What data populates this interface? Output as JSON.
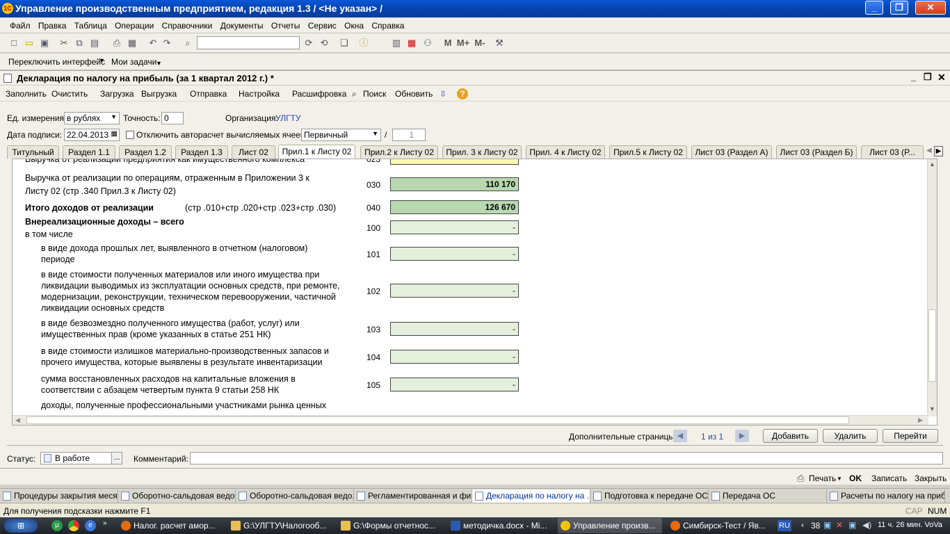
{
  "app": {
    "title": "Управление производственным предприятием, редакция 1.3 / <Не указан> /",
    "logo": "1С"
  },
  "menu": [
    "Файл",
    "Правка",
    "Таблица",
    "Операции",
    "Справочники",
    "Документы",
    "Отчеты",
    "Сервис",
    "Окна",
    "Справка"
  ],
  "toolbar": {
    "search_value": "",
    "m": "M",
    "m_plus": "M+",
    "m_minus": "M-"
  },
  "toolbar2": {
    "switch_interface": "Переключить интерфейс",
    "my_tasks": "Мои задачи"
  },
  "document": {
    "title": "Декларация по налогу на прибыль (за 1 квартал 2012 г.) *",
    "menu": [
      "Заполнить",
      "Очистить",
      "Загрузка",
      "Выгрузка",
      "Отправка",
      "Настройка",
      "Расшифровка",
      "Поиск",
      "Обновить"
    ],
    "units_label": "Ед. измерения:",
    "units_value": "в рублях",
    "precision_label": "Точность:",
    "precision_value": "0",
    "org_label": "Организация:",
    "org_value": "УЛГТУ",
    "sign_date_label": "Дата подписи:",
    "sign_date_value": "22.04.2013",
    "autocalc_label": "Отключить авторасчет вычисляемых ячеек",
    "doc_type_value": "Первичный",
    "slash": "/",
    "correction_value": "1"
  },
  "tabs": [
    "Титульный",
    "Раздел 1.1",
    "Раздел 1.2",
    "Раздел 1.3",
    "Лист 02",
    "Прил.1 к Листу 02",
    "Прил.2 к Листу 02",
    "Прил. 3 к Листу 02",
    "Прил. 4 к Листу 02",
    "Прил.5 к Листу 02",
    "Лист 03 (Раздел А)",
    "Лист 03 (Раздел Б)",
    "Лист 03 (Р..."
  ],
  "active_tab_index": 5,
  "sheet": {
    "top_partial": {
      "text": "Выручка от реализации предприятия как имущественного комплекса",
      "code": "023",
      "value": "-"
    },
    "rows": [
      {
        "l1": "Выручка от реализации по операциям, отраженным в Приложении 3 к",
        "l2": "Листу 02 (стр .340 Прил.3 к Листу 02)",
        "code": "030",
        "value": "110 170"
      },
      {
        "l1": "Итого доходов от реализации",
        "extra": "(стр .010+стр .020+стр .023+стр .030)",
        "code": "040",
        "value": "126 670"
      },
      {
        "l1": "Внереализационные доходы – всего",
        "l2": "в том числе",
        "code": "100",
        "value": "-"
      },
      {
        "l1": "в виде дохода прошлых лет, выявленного в отчетном (налоговом)",
        "l2": "периоде",
        "code": "101",
        "value": "-"
      },
      {
        "l1": "в виде стоимости полученных материалов или иного имущества при",
        "l2": "ликвидации выводимых из эксплуатации основных средств, при ремонте,",
        "l3": "модернизации, реконструкции, техническом перевооружении, частичной",
        "l4": "ликвидации основных средств",
        "code": "102",
        "value": "-"
      },
      {
        "l1": "в виде безвозмездно полученного имущества (работ, услуг) или",
        "l2": "имущественных прав (кроме указанных в статье 251 НК)",
        "code": "103",
        "value": "-"
      },
      {
        "l1": "в виде стоимости излишков материально-производственных запасов и",
        "l2": "прочего имущества, которые выявлены в результате инвентаризации",
        "code": "104",
        "value": "-"
      },
      {
        "l1": "сумма восстановленных расходов на капитальные вложения в",
        "l2": "соответствии с абзацем четвертым пункта 9 статьи 258 НК",
        "code": "105",
        "value": "-"
      },
      {
        "l1": "доходы, полученные профессиональными участниками рынка ценных"
      }
    ]
  },
  "pages": {
    "label": "Дополнительные страницы:",
    "counter": "1 из 1",
    "add": "Добавить",
    "delete": "Удалить",
    "go": "Перейти"
  },
  "footer": {
    "status_label": "Статус:",
    "status_value": "В работе",
    "comment_label": "Комментарий:",
    "comment_value": "",
    "print": "Печать",
    "ok": "OK",
    "save": "Записать",
    "close": "Закрыть"
  },
  "window_tasks": [
    "Процедуры закрытия меся...",
    "Оборотно-сальдовая ведо...",
    "Оборотно-сальдовая ведо...",
    "Регламентированная и фи...",
    "Декларация по налогу на ...",
    "Подготовка к передаче ОС",
    "Передача ОС",
    "Расчеты по налогу на приб..."
  ],
  "statusbar": {
    "hint": "Для получения подсказки нажмите F1",
    "cap": "CAP",
    "num": "NUM"
  },
  "os_taskbar": {
    "items": [
      "Налог. расчет амор...",
      "G:\\УЛГТУ\\Налогооб...",
      "G:\\Формы отчетнос...",
      "методичка.docx - Mi...",
      "Управление произв...",
      "Симбирск-Тест / Яв..."
    ],
    "lang": "RU",
    "tray_num": "38",
    "clock": "11 ч. 26 мин. VoVa"
  },
  "colors": {
    "title_blue": "#0846b4",
    "cell_green": "#e4f0dc",
    "cell_dark": "#b8d8b0",
    "cell_yellow": "#fafab0"
  }
}
